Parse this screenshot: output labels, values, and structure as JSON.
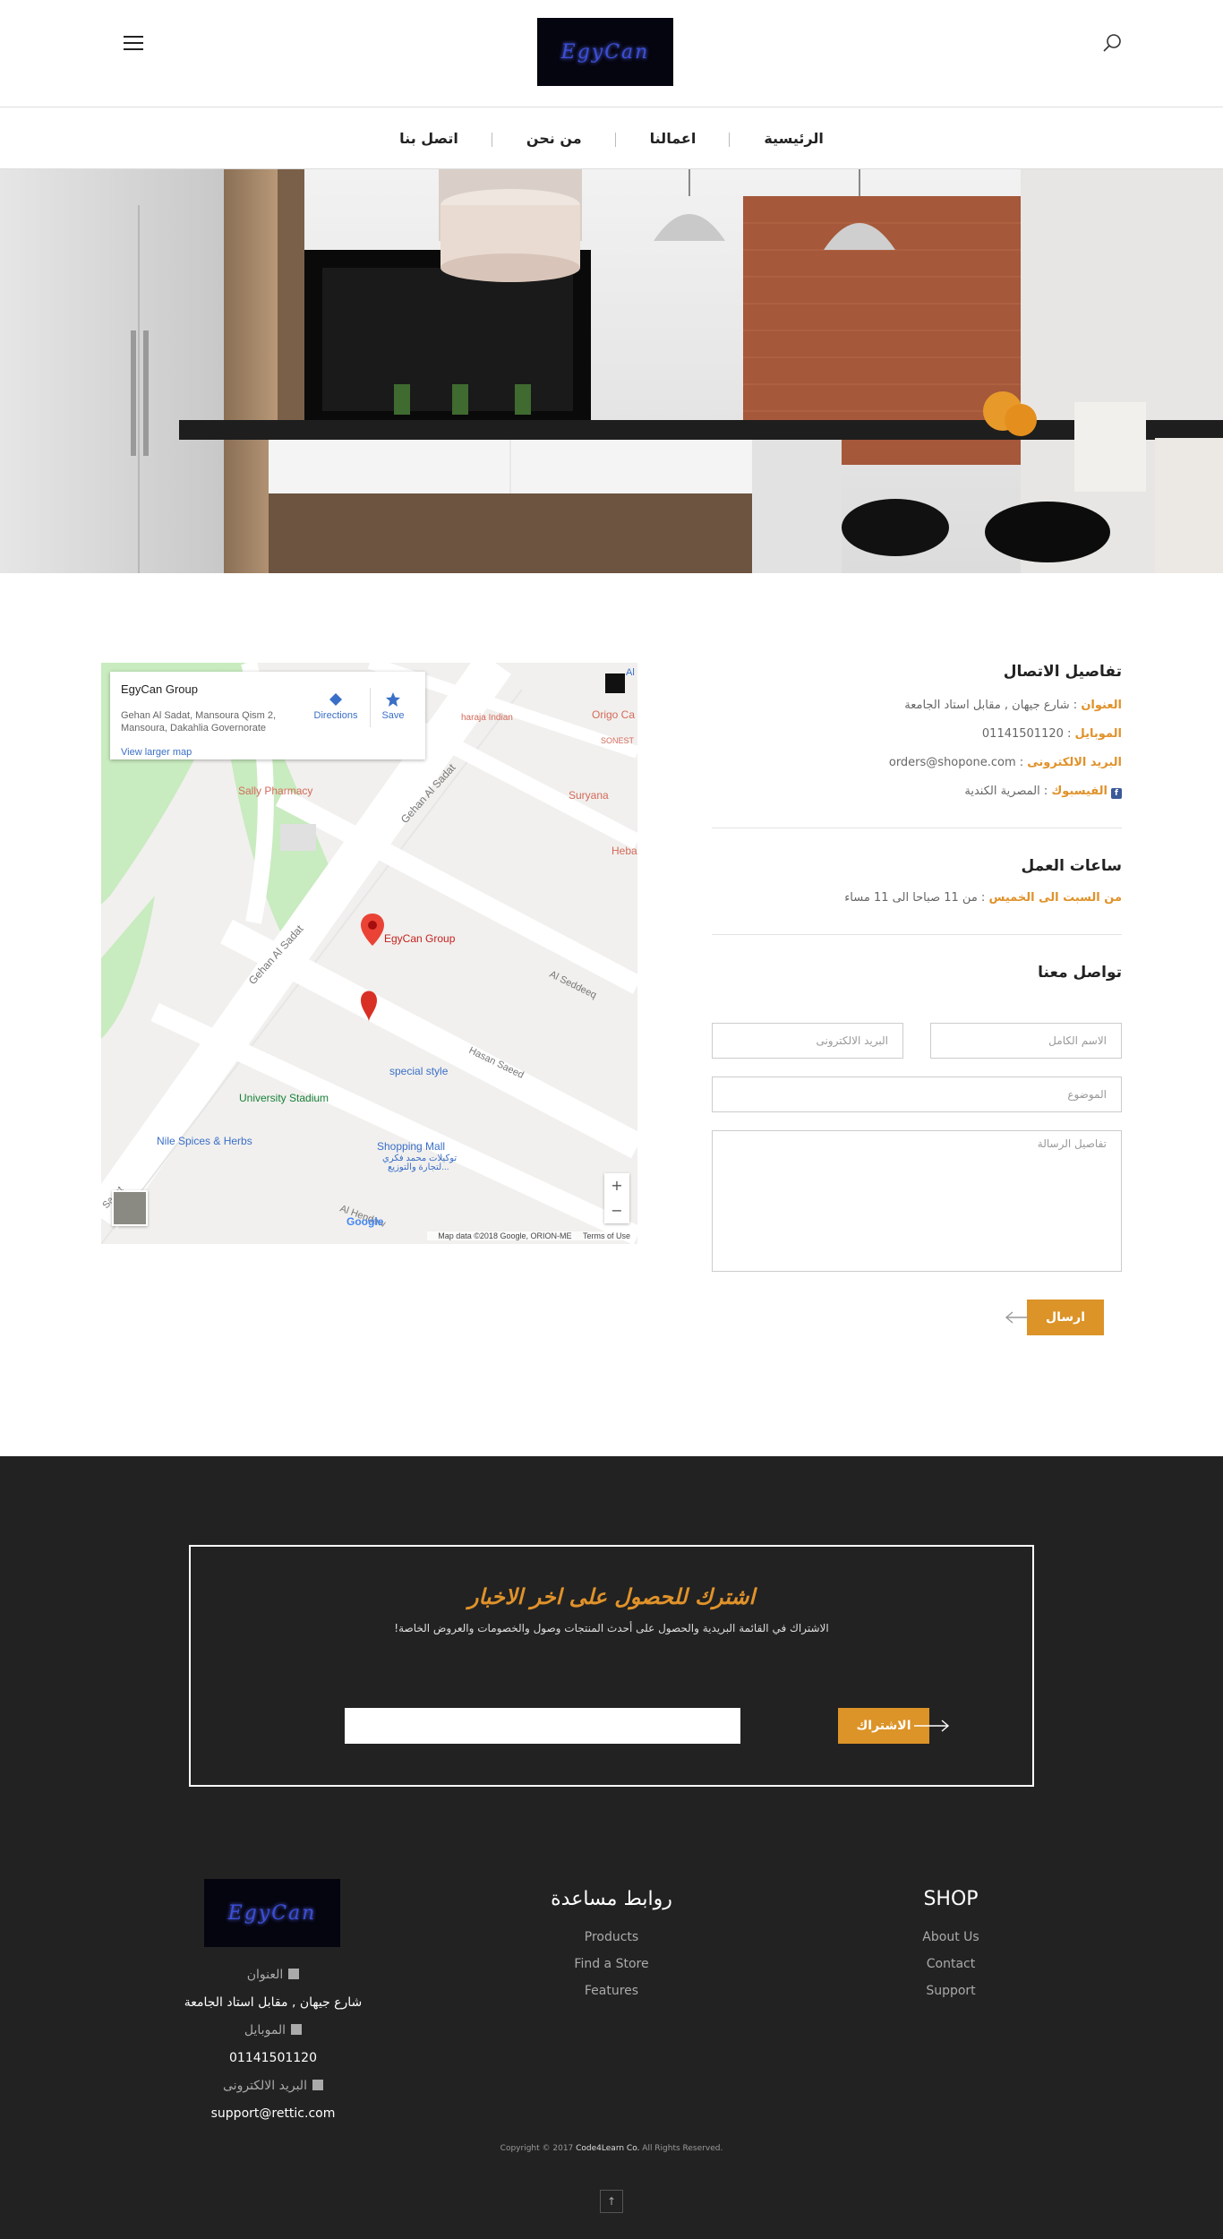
{
  "header": {
    "logo_text": "EgyCan",
    "nav": [
      "الرئيسية",
      "اعمالنا",
      "من نحن",
      "اتصل بنا"
    ]
  },
  "map": {
    "card_title": "EgyCan Group",
    "card_address": "Gehan Al Sadat, Mansoura Qism 2, Mansoura, Dakahlia Governorate",
    "directions": "Directions",
    "save": "Save",
    "view_larger": "View larger map",
    "labels": {
      "pin": "EgyCan Group",
      "sally": "Sally Pharmacy",
      "street1": "Gehan Al Sadat",
      "street2": "Gehan Al Sadat",
      "seddeeq": "Al Seddeeq",
      "hasan": "Hasan Saeed",
      "special": "special style",
      "stadium": "University Stadium",
      "nile": "Nile Spices & Herbs",
      "mall": "Shopping Mall",
      "mall_ar1": "توكيلات محمد فكري",
      "mall_ar2": "لتجارة والتوزيع...",
      "suryana": "Suryana",
      "origo": "Origo Ca",
      "sonesta": "SONEST",
      "heba": "Heba",
      "maharaja": "haraja Indian",
      "al": "Al",
      "sadat_short": "Sadat",
      "al_hendaw": "Al Hendaw",
      "google": "Google"
    },
    "footer_data": "Map data ©2018 Google, ORION-ME",
    "footer_terms": "Terms of Use"
  },
  "contact": {
    "details_title": "تفاصيل الاتصال",
    "address_key": "العنوان",
    "address_val": " : شارع جيهان , مقابل استاد الجامعة",
    "mobile_key": "الموبايل",
    "mobile_val": " : 01141501120",
    "email_key": "البريد الالكترونى",
    "email_val": " : orders@shopone.com",
    "facebook_key": "الفيسبوك",
    "facebook_val": " : المصرية الكندية",
    "hours_title": "ساعات العمل",
    "hours_key": "من السبت الى الخميس",
    "hours_val": " : من 11 صباحا الى 11 مساء",
    "form_title": "تواصل معنا"
  },
  "form": {
    "name_placeholder": "الاسم الكامل",
    "email_placeholder": "البريد الالكترونى",
    "subject_placeholder": "الموضوع",
    "message_placeholder": "تفاصيل الرسالة",
    "send": "ارسال"
  },
  "newsletter": {
    "title": "اشترك للحصول على اخر الاخبار",
    "subtitle": "الاشتراك في القائمة البريدية والحصول على أحدث المنتجات وصول والخصومات والعروض الخاصة!",
    "button": "الاشتراك"
  },
  "footer": {
    "logo_text": "EgyCan",
    "address_label": "العنوان",
    "address_val": "شارع جيهان , مقابل استاد الجامعة",
    "mobile_label": "الموبايل",
    "mobile_val": "01141501120",
    "email_label": "البريد الالكترونى",
    "email_val": "support@rettic.com",
    "help_title": "روابط مساعدة",
    "help_links": [
      "Products",
      "Find a Store",
      "Features"
    ],
    "shop_title": "SHOP",
    "shop_links": [
      "About Us",
      "Contact",
      "Support"
    ],
    "copyright_pre": "Copyright © 2017 ",
    "copyright_company": "Code4Learn Co.",
    "copyright_post": " All Rights Reserved.",
    "to_top": "↑"
  },
  "colors": {
    "accent": "#dc9327",
    "footer_bg": "#222222"
  }
}
